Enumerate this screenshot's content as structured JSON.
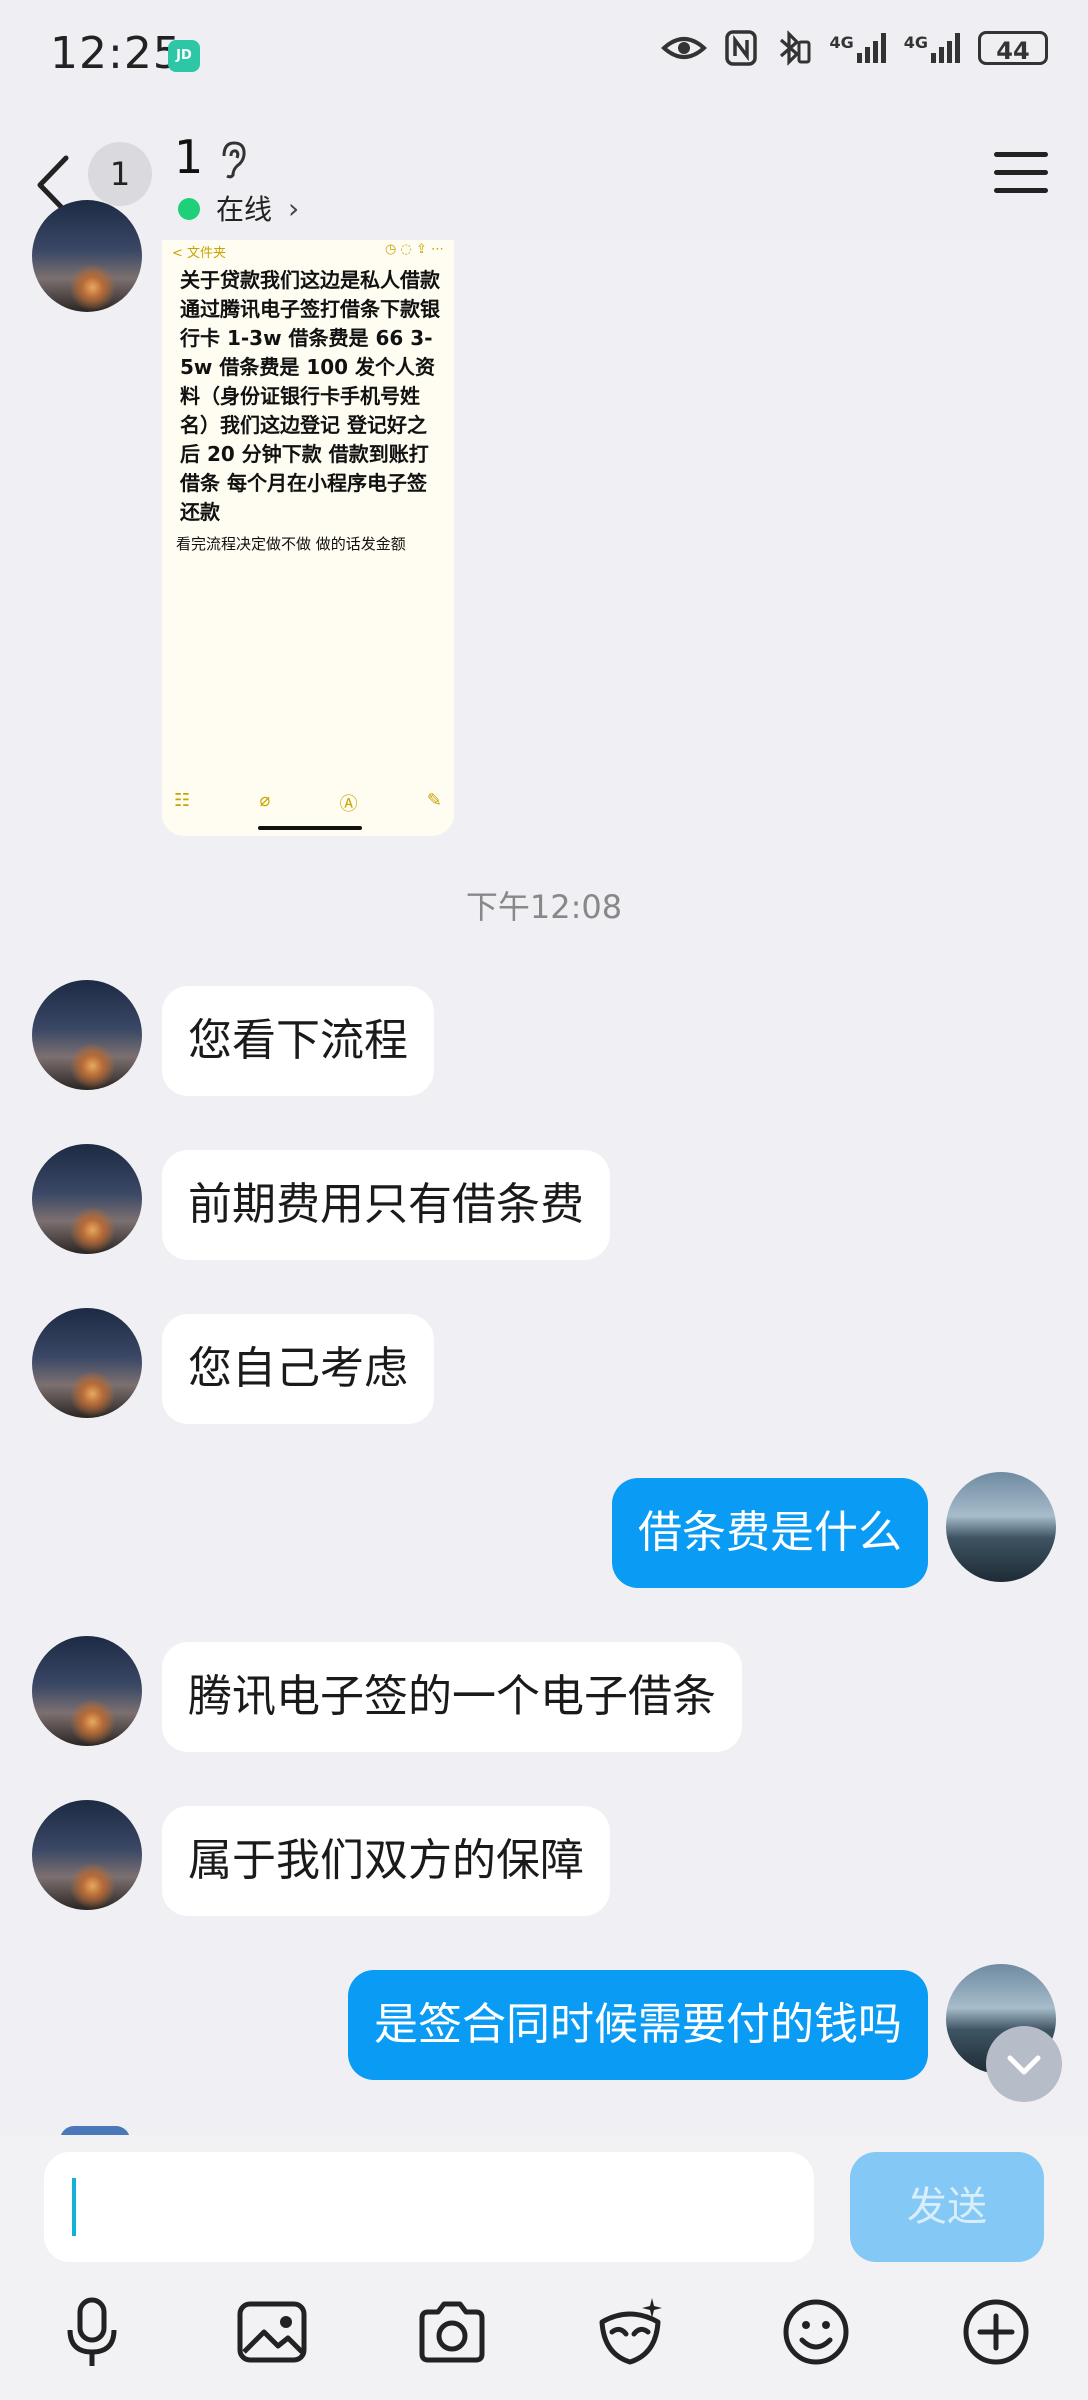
{
  "status_bar": {
    "time": "12:25",
    "app_badge": "JD",
    "network_1": "4G",
    "network_2": "4G",
    "battery": "44"
  },
  "header": {
    "unread_count": "1",
    "title": "1",
    "status_text": "在线"
  },
  "image_message": {
    "topbar_label": "< 文件夹",
    "text": "关于贷款我们这边是私人借款 通过腾讯电子签打借条下款银行卡 1-3w 借条费是 66 3-5w 借条费是 100 发个人资料（身份证银行卡手机号姓名）我们这边登记 登记好之后 20 分钟下款 借款到账打借条 每个月在小程序电子签还款",
    "subtext": "看完流程决定做不做 做的话发金额"
  },
  "timestamp": "下午12:08",
  "messages": [
    {
      "side": "in",
      "text": "您看下流程"
    },
    {
      "side": "in",
      "text": "前期费用只有借条费"
    },
    {
      "side": "in",
      "text": "您自己考虑"
    },
    {
      "side": "out",
      "text": "借条费是什么"
    },
    {
      "side": "in",
      "text": "腾讯电子签的一个电子借条"
    },
    {
      "side": "in",
      "text": "属于我们双方的保障"
    },
    {
      "side": "out",
      "text": "是签合同时候需要付的钱吗"
    }
  ],
  "input": {
    "value": "",
    "send_label": "发送"
  },
  "toolbar": {
    "icons": [
      "microphone-icon",
      "image-icon",
      "camera-icon",
      "sticker-icon",
      "emoji-icon",
      "plus-icon"
    ]
  },
  "colors": {
    "outgoing_bubble": "#0a9bf5",
    "incoming_bubble": "#ffffff",
    "background": "#f0f0f4",
    "online_dot": "#1fd07a",
    "send_button": "#84c8f5"
  }
}
